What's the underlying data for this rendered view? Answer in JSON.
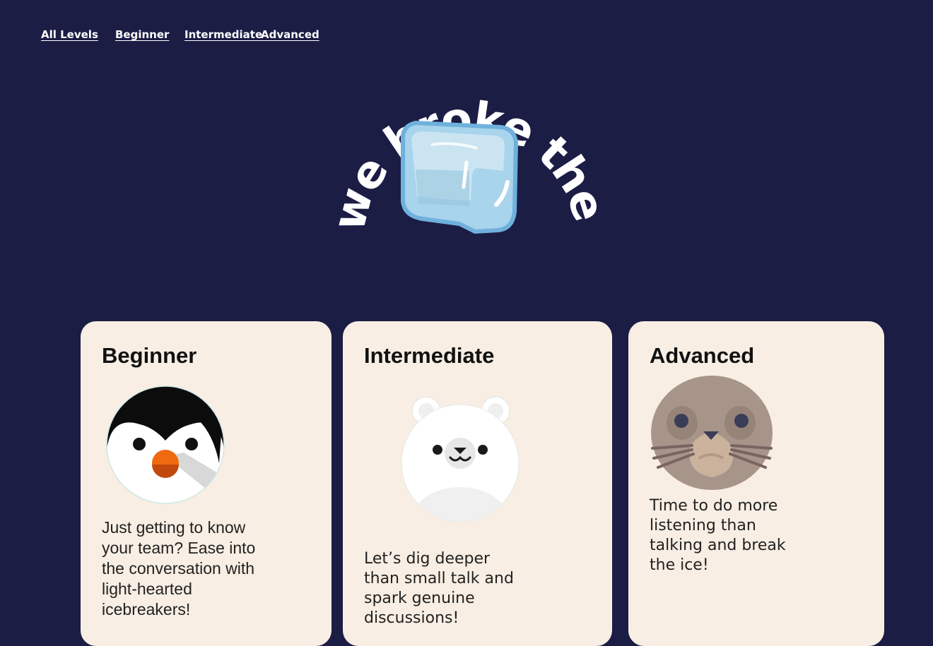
{
  "nav": {
    "items": [
      {
        "label": "All Levels"
      },
      {
        "label": "Beginner"
      },
      {
        "label": "Intermediate"
      },
      {
        "label": "Advanced"
      }
    ]
  },
  "logo": {
    "text": "we broke the ice.",
    "icon": "ice-cube-icon"
  },
  "cards": [
    {
      "title": "Beginner",
      "icon": "penguin-icon",
      "description": "Just getting to know your team? Ease into the conversation with light-hearted icebreakers!"
    },
    {
      "title": "Intermediate",
      "icon": "polar-bear-icon",
      "description": "Let’s dig deeper than small talk and spark genuine discussions!"
    },
    {
      "title": "Advanced",
      "icon": "seal-icon",
      "description": "Time to do more listening than talking and break the ice!"
    }
  ],
  "colors": {
    "background": "#1b1d45",
    "card": "#f8eee3",
    "nav_text": "#ffffff"
  }
}
